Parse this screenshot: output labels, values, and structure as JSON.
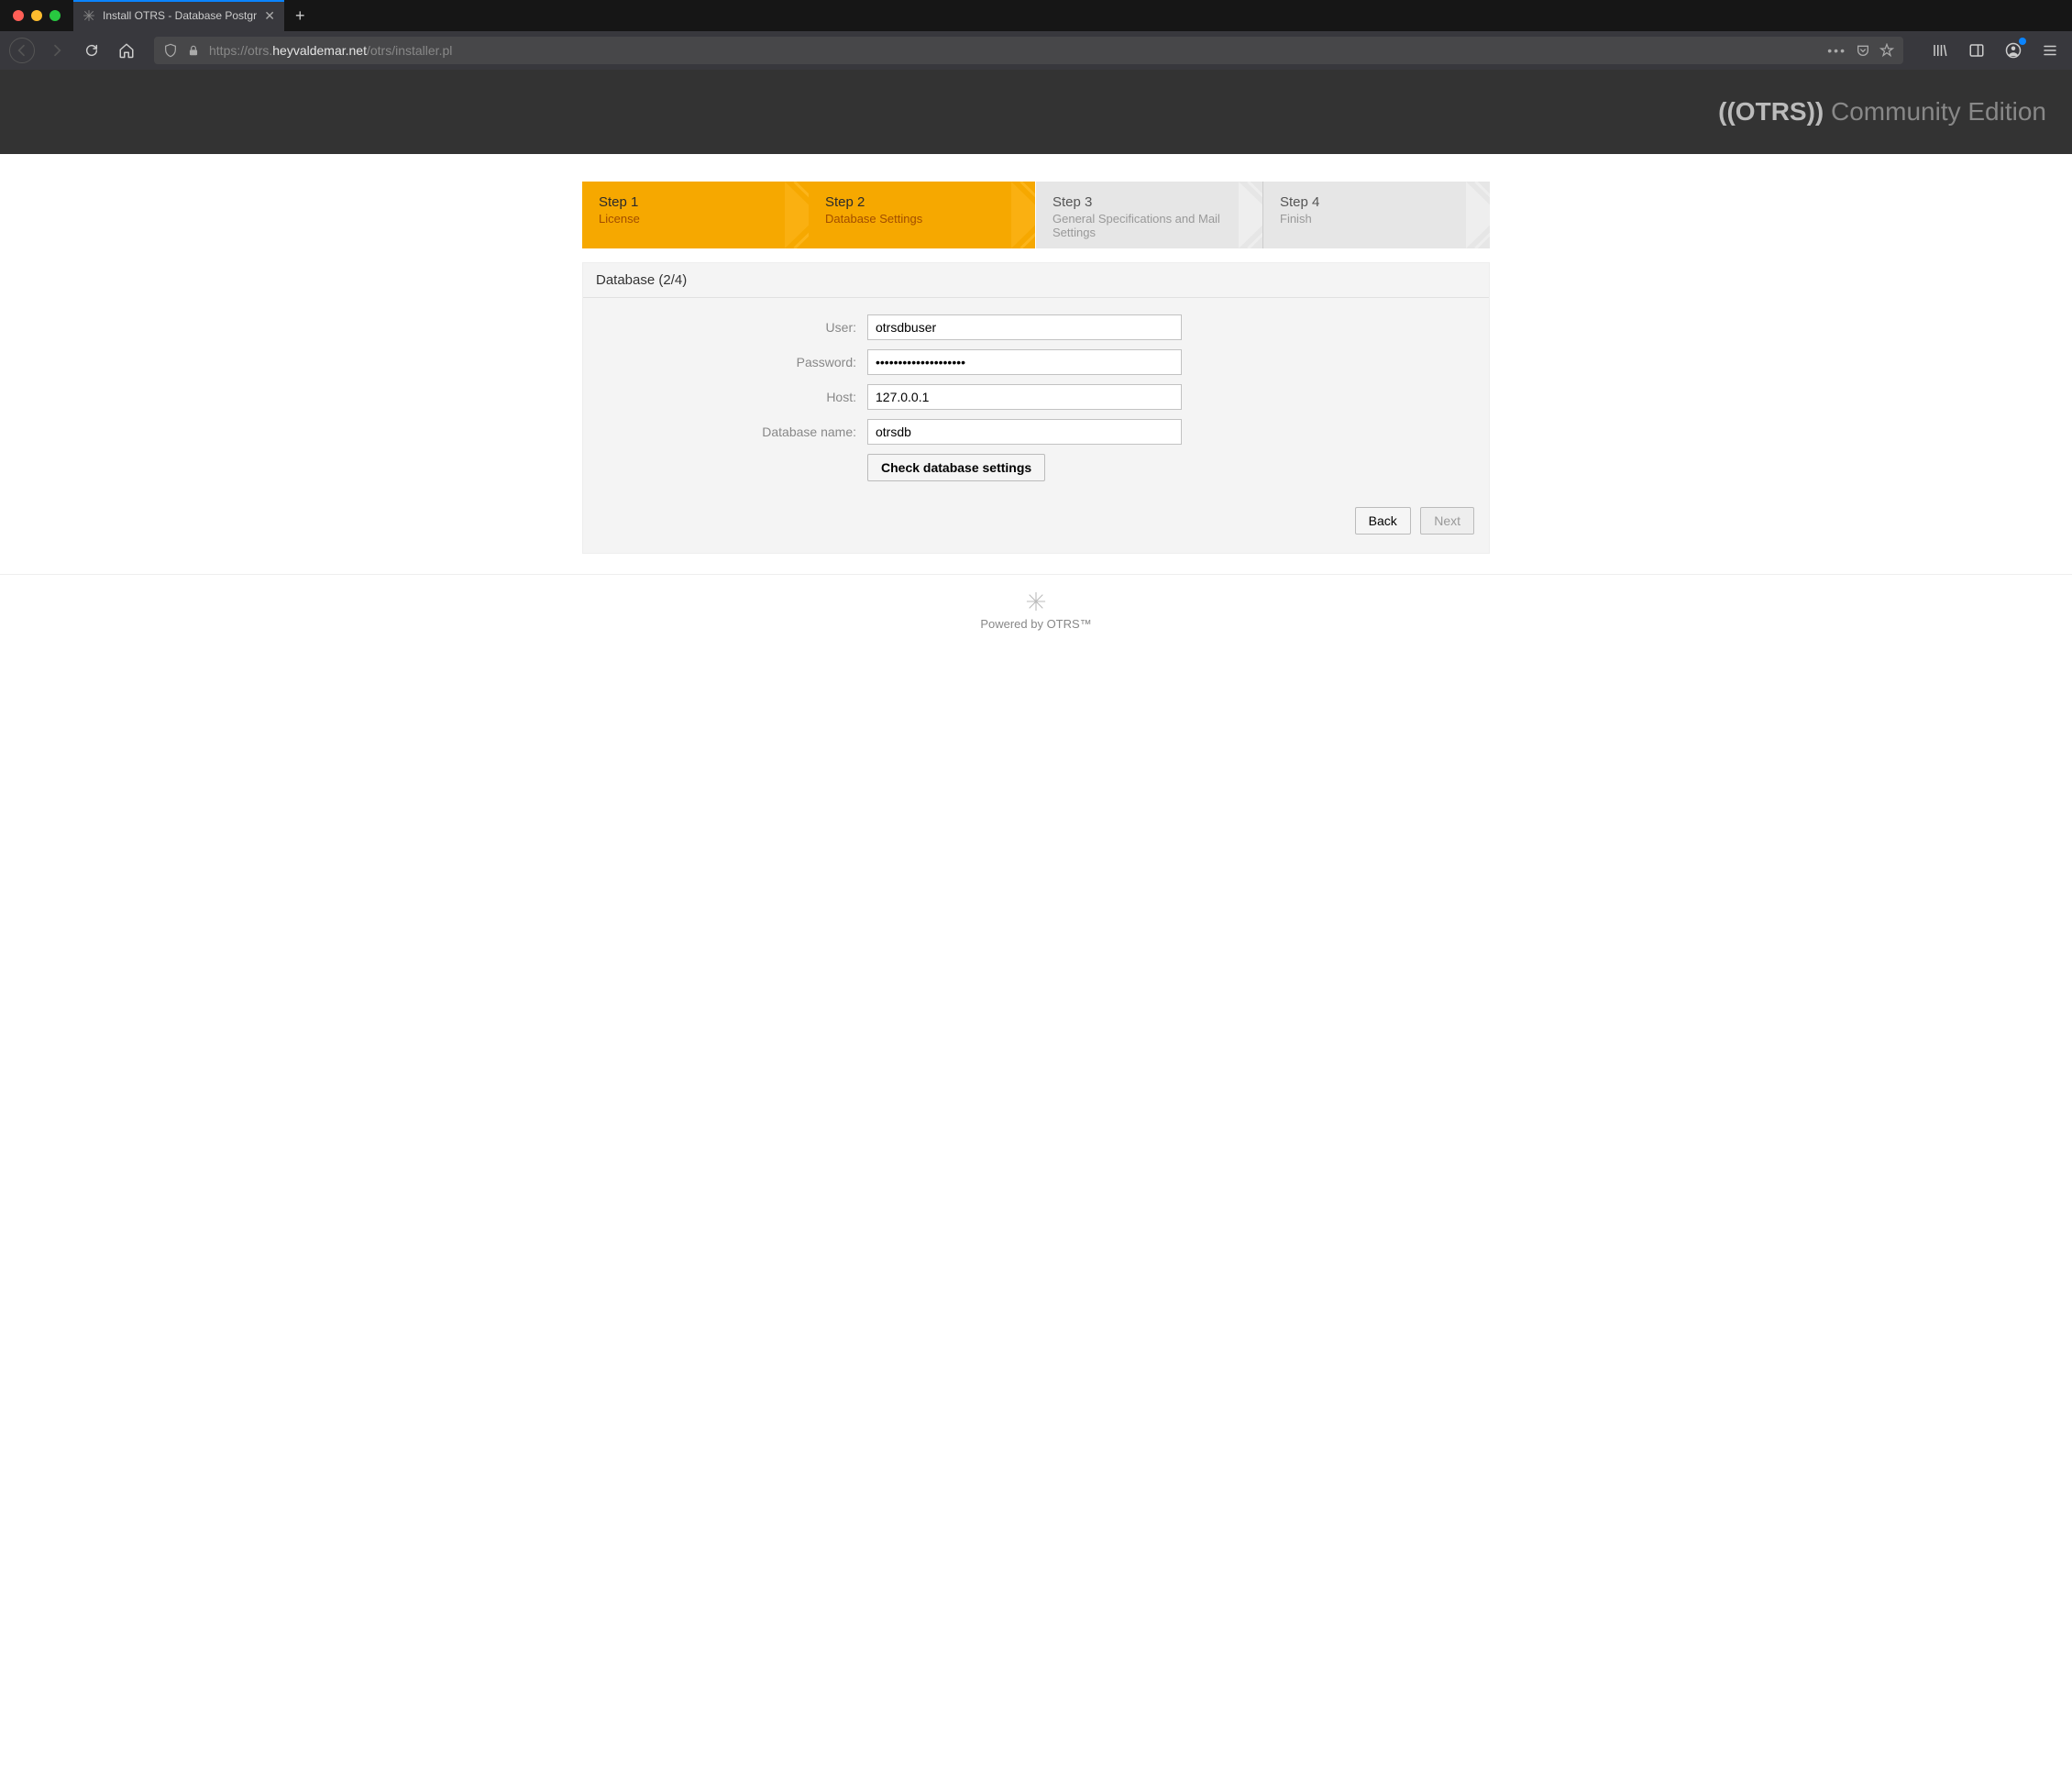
{
  "browser": {
    "tab_title": "Install OTRS - Database Postgr",
    "url_prefix": "https://otrs.",
    "url_domain": "heyvaldemar.net",
    "url_path": "/otrs/installer.pl"
  },
  "header": {
    "brand_logo": "((OTRS))",
    "brand_suffix": " Community Edition"
  },
  "wizard": {
    "steps": [
      {
        "title": "Step 1",
        "subtitle": "License",
        "active": true
      },
      {
        "title": "Step 2",
        "subtitle": "Database Settings",
        "active": true
      },
      {
        "title": "Step 3",
        "subtitle": "General Specifications and Mail Settings",
        "active": false
      },
      {
        "title": "Step 4",
        "subtitle": "Finish",
        "active": false
      }
    ]
  },
  "panel": {
    "title": "Database (2/4)",
    "form": {
      "user_label": "User:",
      "user_value": "otrsdbuser",
      "password_label": "Password:",
      "password_value": "••••••••••••••••••••",
      "host_label": "Host:",
      "host_value": "127.0.0.1",
      "dbname_label": "Database name:",
      "dbname_value": "otrsdb",
      "check_button": "Check database settings"
    },
    "footer": {
      "back": "Back",
      "next": "Next"
    }
  },
  "footer": {
    "text": "Powered by OTRS™"
  }
}
